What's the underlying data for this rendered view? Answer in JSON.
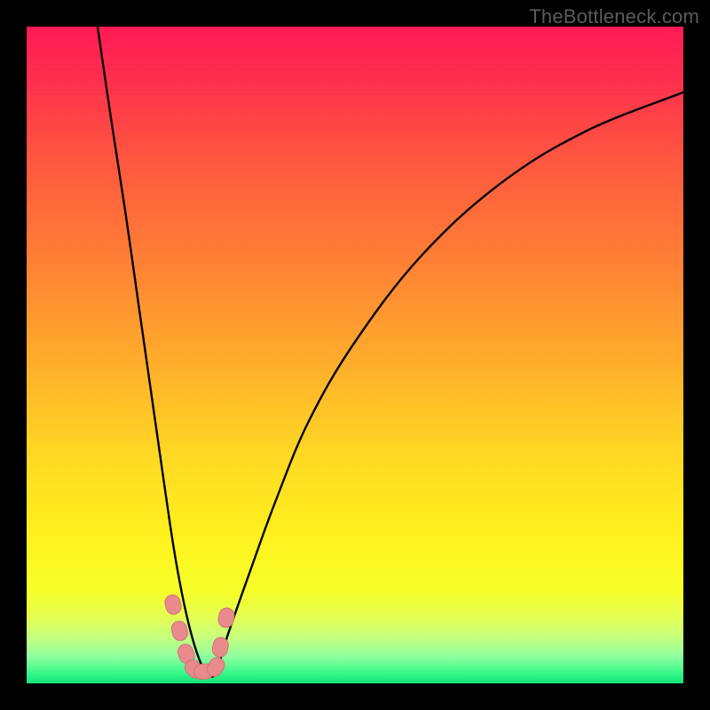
{
  "watermark": {
    "text": "TheBottleneck.com"
  },
  "colors": {
    "frame": "#000000",
    "curve": "#000000",
    "dot_fill": "#e98b8d",
    "dot_stroke": "#d07274",
    "grad_stops": [
      {
        "offset": 0.0,
        "color": "#ff1a55"
      },
      {
        "offset": 0.08,
        "color": "#ff2f4e"
      },
      {
        "offset": 0.2,
        "color": "#ff5640"
      },
      {
        "offset": 0.35,
        "color": "#ff7e35"
      },
      {
        "offset": 0.5,
        "color": "#ffaa2c"
      },
      {
        "offset": 0.65,
        "color": "#ffd824"
      },
      {
        "offset": 0.78,
        "color": "#fff21e"
      },
      {
        "offset": 0.86,
        "color": "#f6ff2a"
      },
      {
        "offset": 0.9,
        "color": "#e4ff54"
      },
      {
        "offset": 0.93,
        "color": "#c6ff7e"
      },
      {
        "offset": 0.96,
        "color": "#8dffa0"
      },
      {
        "offset": 0.985,
        "color": "#36f88a"
      },
      {
        "offset": 1.0,
        "color": "#14e37a"
      }
    ]
  },
  "chart_data": {
    "type": "line",
    "title": "",
    "xlabel": "",
    "ylabel": "",
    "xlim": [
      0,
      100
    ],
    "ylim": [
      0,
      100
    ],
    "grid": false,
    "series": [
      {
        "name": "bottleneck-curve",
        "x": [
          10.8,
          13,
          15,
          17,
          19,
          21,
          22.5,
          24,
          25.5,
          27,
          28,
          29,
          30.5,
          34,
          38,
          43,
          50,
          60,
          72,
          85,
          100
        ],
        "y": [
          100,
          85,
          72,
          58,
          44,
          30,
          20,
          12,
          6,
          2,
          1,
          2,
          7,
          17,
          28,
          40,
          52,
          65,
          76,
          84,
          90
        ]
      }
    ],
    "dots": {
      "name": "highlight-dots",
      "x": [
        22.3,
        23.3,
        24.3,
        25.5,
        27.0,
        28.8,
        29.5,
        30.4
      ],
      "y": [
        12.0,
        8.0,
        4.5,
        2.2,
        1.8,
        2.5,
        5.5,
        10.0
      ]
    }
  }
}
